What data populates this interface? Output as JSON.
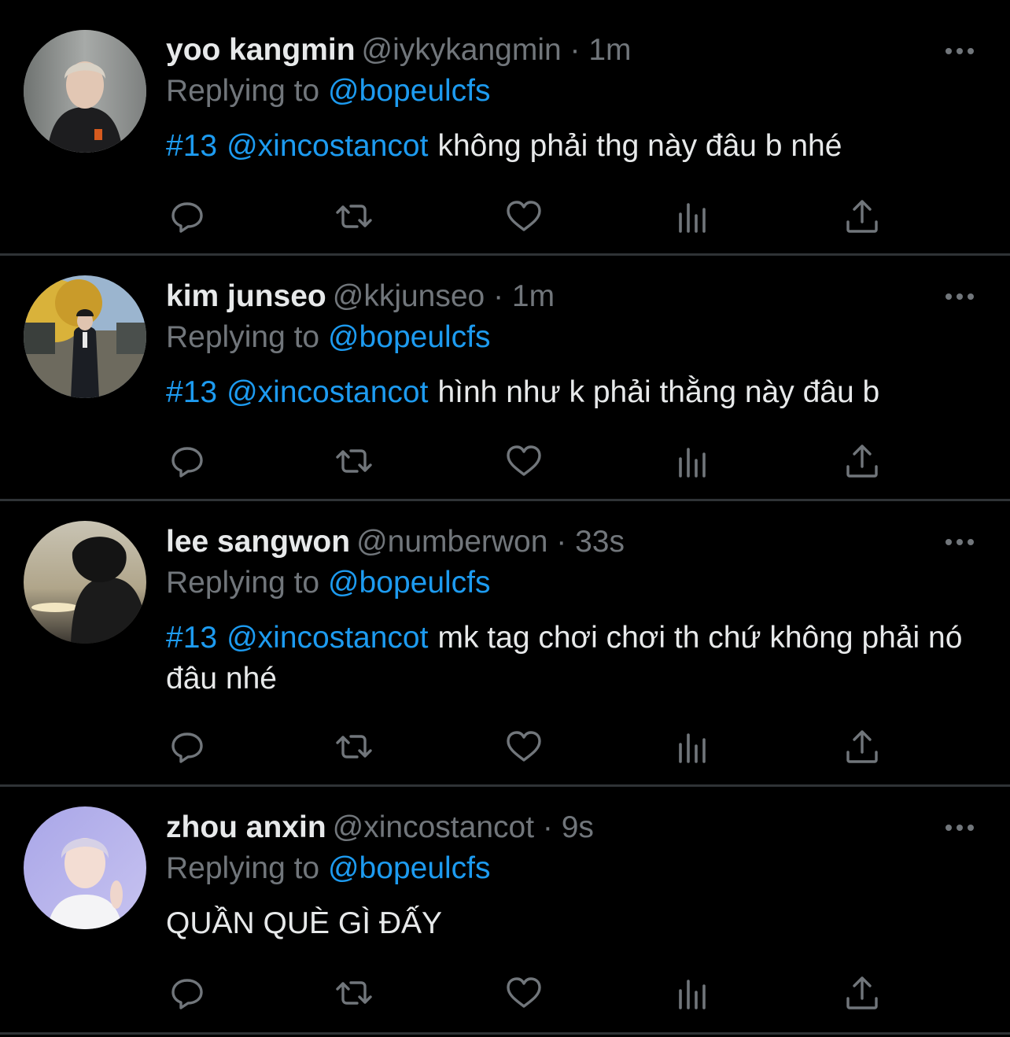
{
  "colors": {
    "background": "#000000",
    "text_primary": "#e7e9ea",
    "text_secondary": "#71767b",
    "link": "#1d9bf0",
    "divider": "#2f3336"
  },
  "action_icons": [
    "reply-icon",
    "retweet-icon",
    "like-icon",
    "view-stats-icon",
    "share-icon"
  ],
  "tweets": [
    {
      "display_name": "yoo kangmin",
      "meta": "@iykykangmin · 1m",
      "replying_prefix": "Replying to",
      "replying_handle": "@bopeulcfs",
      "hashtag": "#13",
      "mention": "@xincostancot",
      "text": "không phải thg này đâu b nhé"
    },
    {
      "display_name": "kim junseo",
      "meta": "@kkjunseo · 1m",
      "replying_prefix": "Replying to",
      "replying_handle": "@bopeulcfs",
      "hashtag": "#13",
      "mention": "@xincostancot",
      "text": "hình như k phải thằng này đâu b"
    },
    {
      "display_name": "lee sangwon",
      "meta": "@numberwon · 33s",
      "replying_prefix": "Replying to",
      "replying_handle": "@bopeulcfs",
      "hashtag": "#13",
      "mention": "@xincostancot",
      "text": "mk tag chơi chơi th chứ không phải nó đâu nhé"
    },
    {
      "display_name": "zhou anxin",
      "meta": "@xincostancot · 9s",
      "replying_prefix": "Replying to",
      "replying_handle": "@bopeulcfs",
      "text": "QUẦN QUÈ GÌ ĐẤY"
    }
  ]
}
